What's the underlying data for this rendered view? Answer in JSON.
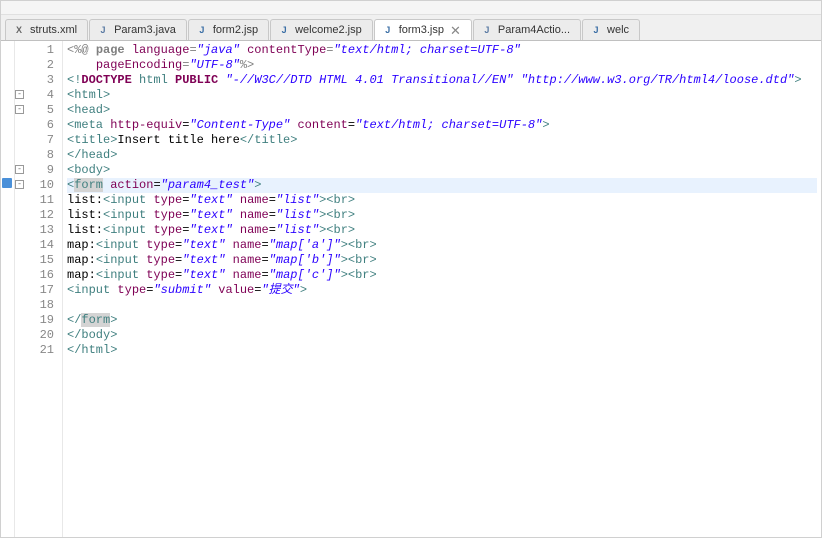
{
  "tabs": [
    {
      "label": "struts.xml",
      "iconType": "xml",
      "active": false
    },
    {
      "label": "Param3.java",
      "iconType": "java",
      "active": false
    },
    {
      "label": "form2.jsp",
      "iconType": "jsp",
      "active": false
    },
    {
      "label": "welcome2.jsp",
      "iconType": "jsp",
      "active": false
    },
    {
      "label": "form3.jsp",
      "iconType": "jsp",
      "active": true
    },
    {
      "label": "Param4Actio...",
      "iconType": "java",
      "active": false
    },
    {
      "label": "welc",
      "iconType": "jsp",
      "active": false
    }
  ],
  "code": {
    "lines": [
      {
        "n": "1",
        "fold": "",
        "html": "<span class='t-dir'>&lt;%@ </span><span class='t-dirkw'>page</span><span class='t-dir'> </span><span class='t-attr'>language</span><span class='t-dir'>=</span><span class='t-str'>\"java\"</span><span class='t-dir'> </span><span class='t-attr'>contentType</span><span class='t-dir'>=</span><span class='t-str'>\"text/html; charset=UTF-8\"</span>"
      },
      {
        "n": "2",
        "fold": "",
        "html": "    <span class='t-attr'>pageEncoding</span><span class='t-dir'>=</span><span class='t-str'>\"UTF-8\"</span><span class='t-dir'>%&gt;</span>"
      },
      {
        "n": "3",
        "fold": "",
        "html": "<span class='t-doctype'>&lt;!</span><span class='t-kw'>DOCTYPE </span><span class='t-doctype'>html </span><span class='t-kw'>PUBLIC </span><span class='t-str'>\"-//W3C//DTD HTML 4.01 Transitional//EN\" \"http://www.w3.org/TR/html4/loose.dtd\"</span><span class='t-doctype'>&gt;</span>"
      },
      {
        "n": "4",
        "fold": "-",
        "html": "<span class='t-tag'>&lt;html&gt;</span>"
      },
      {
        "n": "5",
        "fold": "-",
        "html": "<span class='t-tag'>&lt;head&gt;</span>"
      },
      {
        "n": "6",
        "fold": "",
        "html": "<span class='t-tag'>&lt;meta</span> <span class='t-attr'>http-equiv</span>=<span class='t-str'>\"Content-Type\"</span> <span class='t-attr'>content</span>=<span class='t-str'>\"text/html; charset=UTF-8\"</span><span class='t-tag'>&gt;</span>"
      },
      {
        "n": "7",
        "fold": "",
        "html": "<span class='t-tag'>&lt;title&gt;</span><span class='t-txt'>Insert title here</span><span class='t-tag'>&lt;/title&gt;</span>"
      },
      {
        "n": "8",
        "fold": "",
        "html": "<span class='t-tag'>&lt;/head&gt;</span>"
      },
      {
        "n": "9",
        "fold": "-",
        "html": "<span class='t-tag'>&lt;body&gt;</span>"
      },
      {
        "n": "10",
        "fold": "-",
        "hl": true,
        "mk": true,
        "html": "<span class='t-tag'>&lt;<span class='t-hl'>form</span></span> <span class='t-attr'>action</span>=<span class='t-str'>\"param4_test\"</span><span class='t-tag'>&gt;</span>"
      },
      {
        "n": "11",
        "fold": "",
        "html": "<span class='t-txt'>list:</span><span class='t-tag'>&lt;input</span> <span class='t-attr'>type</span>=<span class='t-str'>\"text\"</span> <span class='t-attr'>name</span>=<span class='t-str'>\"list\"</span><span class='t-tag'>&gt;&lt;br&gt;</span>"
      },
      {
        "n": "12",
        "fold": "",
        "html": "<span class='t-txt'>list:</span><span class='t-tag'>&lt;input</span> <span class='t-attr'>type</span>=<span class='t-str'>\"text\"</span> <span class='t-attr'>name</span>=<span class='t-str'>\"list\"</span><span class='t-tag'>&gt;&lt;br&gt;</span>"
      },
      {
        "n": "13",
        "fold": "",
        "html": "<span class='t-txt'>list:</span><span class='t-tag'>&lt;input</span> <span class='t-attr'>type</span>=<span class='t-str'>\"text\"</span> <span class='t-attr'>name</span>=<span class='t-str'>\"list\"</span><span class='t-tag'>&gt;&lt;br&gt;</span>"
      },
      {
        "n": "14",
        "fold": "",
        "html": "<span class='t-txt'>map:</span><span class='t-tag'>&lt;input</span> <span class='t-attr'>type</span>=<span class='t-str'>\"text\"</span> <span class='t-attr'>name</span>=<span class='t-str'>\"map['a']\"</span><span class='t-tag'>&gt;&lt;br&gt;</span>"
      },
      {
        "n": "15",
        "fold": "",
        "html": "<span class='t-txt'>map:</span><span class='t-tag'>&lt;input</span> <span class='t-attr'>type</span>=<span class='t-str'>\"text\"</span> <span class='t-attr'>name</span>=<span class='t-str'>\"map['b']\"</span><span class='t-tag'>&gt;&lt;br&gt;</span>"
      },
      {
        "n": "16",
        "fold": "",
        "html": "<span class='t-txt'>map:</span><span class='t-tag'>&lt;input</span> <span class='t-attr'>type</span>=<span class='t-str'>\"text\"</span> <span class='t-attr'>name</span>=<span class='t-str'>\"map['c']\"</span><span class='t-tag'>&gt;&lt;br&gt;</span>"
      },
      {
        "n": "17",
        "fold": "",
        "html": "<span class='t-tag'>&lt;input</span> <span class='t-attr'>type</span>=<span class='t-str'>\"submit\"</span> <span class='t-attr'>value</span>=<span class='t-str'>\"提交\"</span><span class='t-tag'>&gt;</span>"
      },
      {
        "n": "18",
        "fold": "",
        "html": ""
      },
      {
        "n": "19",
        "fold": "",
        "html": "<span class='t-tag'>&lt;/<span class='t-hl'>form</span>&gt;</span>"
      },
      {
        "n": "20",
        "fold": "",
        "html": "<span class='t-tag'>&lt;/body&gt;</span>"
      },
      {
        "n": "21",
        "fold": "",
        "html": "<span class='t-tag'>&lt;/html&gt;</span>"
      }
    ]
  }
}
